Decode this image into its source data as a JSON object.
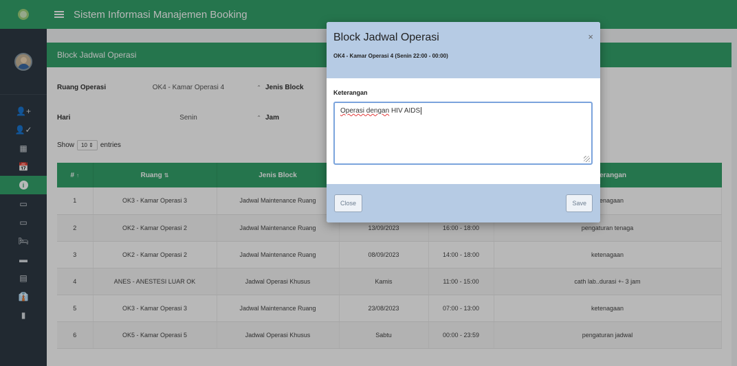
{
  "app": {
    "title": "Sistem Informasi Manajemen Booking"
  },
  "sidebar": {
    "items": [
      {
        "icon": "user-add-icon",
        "glyph": "👤+"
      },
      {
        "icon": "user-check-icon",
        "glyph": "👤✓"
      },
      {
        "icon": "calendar-grid-icon",
        "glyph": "▦"
      },
      {
        "icon": "calendar-icon",
        "glyph": "📅"
      },
      {
        "icon": "info-icon",
        "glyph": "i",
        "active": true
      },
      {
        "icon": "monitor-icon",
        "glyph": "▭"
      },
      {
        "icon": "monitor-icon",
        "glyph": "▭"
      },
      {
        "icon": "bed-icon",
        "glyph": "🛏"
      },
      {
        "icon": "car-icon",
        "glyph": "▬"
      },
      {
        "icon": "server-icon",
        "glyph": "▤"
      },
      {
        "icon": "user-tie-icon",
        "glyph": "👔"
      },
      {
        "icon": "building-icon",
        "glyph": "▮"
      }
    ]
  },
  "panel": {
    "title": "Block Jadwal Operasi",
    "filters": {
      "ruang_label": "Ruang Operasi",
      "ruang_value": "OK4 - Kamar Operasi 4",
      "jenis_label": "Jenis Block",
      "hari_label": "Hari",
      "hari_value": "Senin",
      "jam_label": "Jam"
    },
    "show": {
      "prefix": "Show",
      "value": "10",
      "suffix": "entries"
    }
  },
  "table": {
    "headers": [
      "#",
      "Ruang",
      "Jenis Block",
      "",
      "",
      "Keterangan"
    ],
    "rows": [
      [
        "1",
        "OK3 - Kamar Operasi 3",
        "Jadwal Maintenance Ruang",
        "",
        "",
        "ketenagaan"
      ],
      [
        "2",
        "OK2 - Kamar Operasi 2",
        "Jadwal Maintenance Ruang",
        "13/09/2023",
        "16:00 - 18:00",
        "pengaturan tenaga"
      ],
      [
        "3",
        "OK2 - Kamar Operasi 2",
        "Jadwal Maintenance Ruang",
        "08/09/2023",
        "14:00 - 18:00",
        "ketenagaan"
      ],
      [
        "4",
        "ANES - ANESTESI LUAR OK",
        "Jadwal Operasi Khusus",
        "Kamis",
        "11:00 - 15:00",
        "cath lab..durasi +- 3 jam"
      ],
      [
        "5",
        "OK3 - Kamar Operasi 3",
        "Jadwal Maintenance Ruang",
        "23/08/2023",
        "07:00 - 13:00",
        "ketenagaan"
      ],
      [
        "6",
        "OK5 - Kamar Operasi 5",
        "Jadwal Operasi Khusus",
        "Sabtu",
        "00:00 - 23:59",
        "pengaturan jadwal"
      ]
    ]
  },
  "modal": {
    "title": "Block Jadwal Operasi",
    "subtitle": "OK4 - Kamar Operasi 4 (Senin 22:00 - 00:00)",
    "close_glyph": "×",
    "field_label": "Keterangan",
    "textarea_value_flagged": "Operasi dengan",
    "textarea_value_rest": " HIV AIDS",
    "close_label": "Close",
    "save_label": "Save"
  }
}
